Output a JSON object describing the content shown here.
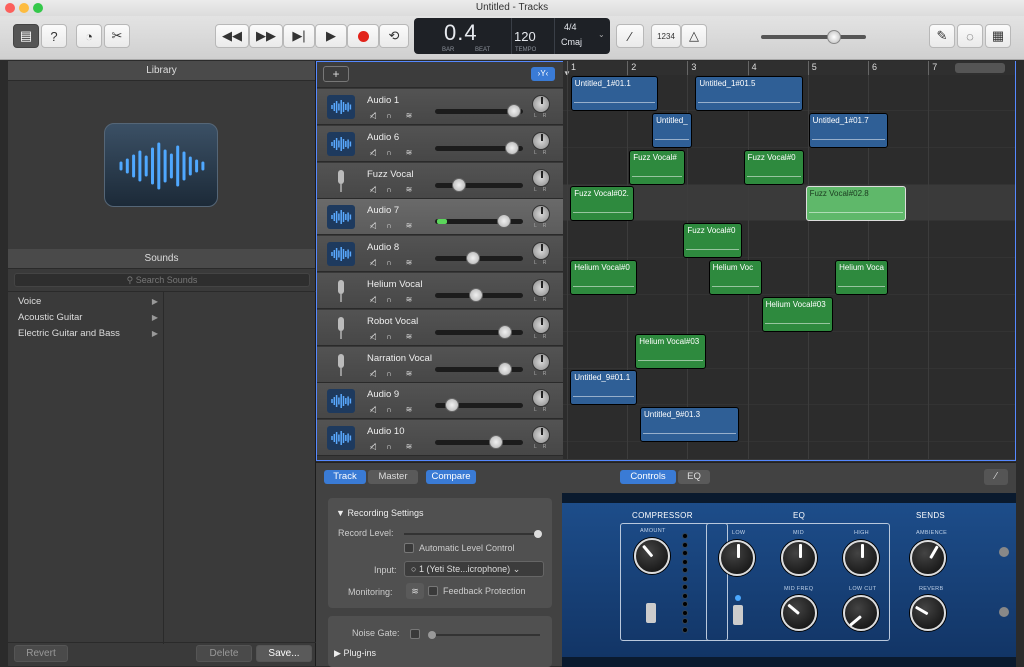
{
  "window": {
    "title": "Untitled - Tracks"
  },
  "transport": {
    "bar_beat": "0.4",
    "bar_label": "BAR",
    "beat_label": "BEAT",
    "tempo": "120",
    "tempo_label": "TEMPO",
    "time_signature": "4/4",
    "key": "Cmaj",
    "count_in": "1234"
  },
  "library": {
    "title": "Library",
    "sounds_title": "Sounds",
    "search_placeholder": "Search Sounds",
    "categories": [
      "Voice",
      "Acoustic Guitar",
      "Electric Guitar and Bass"
    ],
    "revert": "Revert",
    "delete": "Delete",
    "save": "Save..."
  },
  "ruler": [
    "1",
    "2",
    "3",
    "4",
    "5",
    "6",
    "7"
  ],
  "tracks": [
    {
      "name": "Audio 1",
      "type": "wave",
      "volume": 0.95
    },
    {
      "name": "Audio 6",
      "type": "wave",
      "volume": 0.93
    },
    {
      "name": "Fuzz Vocal",
      "type": "mic",
      "volume": 0.26
    },
    {
      "name": "Audio 7",
      "type": "wave",
      "volume": 0.83
    },
    {
      "name": "Audio 8",
      "type": "wave",
      "volume": 0.44
    },
    {
      "name": "Helium Vocal",
      "type": "mic",
      "volume": 0.48
    },
    {
      "name": "Robot Vocal",
      "type": "mic",
      "volume": 0.84
    },
    {
      "name": "Narration Vocal",
      "type": "mic",
      "volume": 0.84
    },
    {
      "name": "Audio 9",
      "type": "wave",
      "volume": 0.18
    },
    {
      "name": "Audio 10",
      "type": "wave",
      "volume": 0.72
    }
  ],
  "regions": [
    {
      "lane": 0,
      "name": "Untitled_1#01.1",
      "color": "blue",
      "start": 1.03,
      "end": 2.48
    },
    {
      "lane": 0,
      "name": "Untitled_1#01.5",
      "color": "blue",
      "start": 3.1,
      "end": 4.88
    },
    {
      "lane": 1,
      "name": "Untitled_",
      "color": "blue",
      "start": 2.38,
      "end": 3.05
    },
    {
      "lane": 1,
      "name": "Untitled_1#01.7",
      "color": "blue",
      "start": 4.98,
      "end": 6.3
    },
    {
      "lane": 2,
      "name": "Fuzz Vocal#",
      "color": "green",
      "start": 2.0,
      "end": 2.92
    },
    {
      "lane": 2,
      "name": "Fuzz Vocal#0",
      "color": "green",
      "start": 3.9,
      "end": 4.9
    },
    {
      "lane": 3,
      "name": "Fuzz Vocal#02.",
      "color": "green",
      "start": 1.02,
      "end": 2.08
    },
    {
      "lane": 3,
      "name": "Fuzz Vocal#02.8",
      "color": "lightgreen",
      "start": 4.93,
      "end": 6.6
    },
    {
      "lane": 4,
      "name": "Fuzz Vocal#0",
      "color": "green",
      "start": 2.9,
      "end": 3.87
    },
    {
      "lane": 5,
      "name": "Helium Vocal#0",
      "color": "green",
      "start": 1.02,
      "end": 2.13
    },
    {
      "lane": 5,
      "name": "Helium Voc",
      "color": "green",
      "start": 3.32,
      "end": 4.2
    },
    {
      "lane": 5,
      "name": "Helium Voca",
      "color": "green",
      "start": 5.42,
      "end": 6.3
    },
    {
      "lane": 6,
      "name": "Helium Vocal#03",
      "color": "green",
      "start": 4.2,
      "end": 5.38
    },
    {
      "lane": 7,
      "name": "Helium Vocal#03",
      "color": "green",
      "start": 2.1,
      "end": 3.27
    },
    {
      "lane": 8,
      "name": "Untitled_9#01.1",
      "color": "blue",
      "start": 1.02,
      "end": 2.13
    },
    {
      "lane": 9,
      "name": "Untitled_9#01.3",
      "color": "blue",
      "start": 2.18,
      "end": 3.82
    }
  ],
  "smart_controls": {
    "tabs": [
      "Track",
      "Master",
      "Compare"
    ],
    "view_tabs": [
      "Controls",
      "EQ"
    ],
    "recording_settings": "Recording Settings",
    "record_level": "Record Level:",
    "auto_level": "Automatic Level Control",
    "input_label": "Input:",
    "input_value": "1 (Yeti Ste...icrophone)",
    "monitoring": "Monitoring:",
    "feedback": "Feedback Protection",
    "noise_gate": "Noise Gate:",
    "plugins": "Plug-ins"
  },
  "plugin": {
    "compressor": "COMPRESSOR",
    "eq": "EQ",
    "sends": "SENDS",
    "amount": "AMOUNT",
    "low": "LOW",
    "mid": "MID",
    "high": "HIGH",
    "mid_freq": "MID FREQ",
    "low_cut": "LOW CUT",
    "ambience": "AMBIENCE",
    "reverb": "REVERB"
  }
}
